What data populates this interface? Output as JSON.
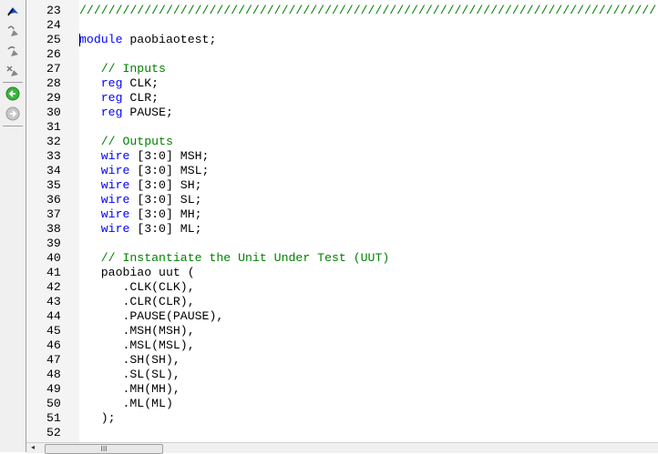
{
  "toolbar": {
    "items": [
      {
        "icon": "bookmark-toggle-icon"
      },
      {
        "icon": "bookmark-previous-icon"
      },
      {
        "icon": "bookmark-next-icon"
      },
      {
        "icon": "bookmark-clear-icon"
      },
      {
        "icon": "back-arrow-icon",
        "color": "#3cb43c"
      },
      {
        "icon": "forward-arrow-icon",
        "color": "#b0b0b0"
      }
    ]
  },
  "colors": {
    "keyword": "#0000ff",
    "comment": "#008000",
    "text": "#000000"
  },
  "lines": [
    {
      "n": "23",
      "tokens": [
        {
          "t": "////////////////////////////////////////////////////////////////////////////////",
          "c": "cm"
        }
      ]
    },
    {
      "n": "24",
      "tokens": []
    },
    {
      "n": "25",
      "tokens": [
        {
          "t": "module",
          "c": "kw"
        },
        {
          "t": " paobiaotest;",
          "c": ""
        }
      ]
    },
    {
      "n": "26",
      "tokens": []
    },
    {
      "n": "27",
      "tokens": [
        {
          "t": "   // Inputs",
          "c": "cm"
        }
      ]
    },
    {
      "n": "28",
      "tokens": [
        {
          "t": "   ",
          "c": ""
        },
        {
          "t": "reg",
          "c": "kw"
        },
        {
          "t": " CLK;",
          "c": ""
        }
      ]
    },
    {
      "n": "29",
      "tokens": [
        {
          "t": "   ",
          "c": ""
        },
        {
          "t": "reg",
          "c": "kw"
        },
        {
          "t": " CLR;",
          "c": ""
        }
      ]
    },
    {
      "n": "30",
      "tokens": [
        {
          "t": "   ",
          "c": ""
        },
        {
          "t": "reg",
          "c": "kw"
        },
        {
          "t": " PAUSE;",
          "c": ""
        }
      ]
    },
    {
      "n": "31",
      "tokens": []
    },
    {
      "n": "32",
      "tokens": [
        {
          "t": "   // Outputs",
          "c": "cm"
        }
      ]
    },
    {
      "n": "33",
      "tokens": [
        {
          "t": "   ",
          "c": ""
        },
        {
          "t": "wire",
          "c": "kw"
        },
        {
          "t": " [3:0] MSH;",
          "c": ""
        }
      ]
    },
    {
      "n": "34",
      "tokens": [
        {
          "t": "   ",
          "c": ""
        },
        {
          "t": "wire",
          "c": "kw"
        },
        {
          "t": " [3:0] MSL;",
          "c": ""
        }
      ]
    },
    {
      "n": "35",
      "tokens": [
        {
          "t": "   ",
          "c": ""
        },
        {
          "t": "wire",
          "c": "kw"
        },
        {
          "t": " [3:0] SH;",
          "c": ""
        }
      ]
    },
    {
      "n": "36",
      "tokens": [
        {
          "t": "   ",
          "c": ""
        },
        {
          "t": "wire",
          "c": "kw"
        },
        {
          "t": " [3:0] SL;",
          "c": ""
        }
      ]
    },
    {
      "n": "37",
      "tokens": [
        {
          "t": "   ",
          "c": ""
        },
        {
          "t": "wire",
          "c": "kw"
        },
        {
          "t": " [3:0] MH;",
          "c": ""
        }
      ]
    },
    {
      "n": "38",
      "tokens": [
        {
          "t": "   ",
          "c": ""
        },
        {
          "t": "wire",
          "c": "kw"
        },
        {
          "t": " [3:0] ML;",
          "c": ""
        }
      ]
    },
    {
      "n": "39",
      "tokens": []
    },
    {
      "n": "40",
      "tokens": [
        {
          "t": "   // Instantiate the Unit Under Test (UUT)",
          "c": "cm"
        }
      ]
    },
    {
      "n": "41",
      "tokens": [
        {
          "t": "   paobiao uut (",
          "c": ""
        }
      ]
    },
    {
      "n": "42",
      "tokens": [
        {
          "t": "      .CLK(CLK),",
          "c": ""
        }
      ]
    },
    {
      "n": "43",
      "tokens": [
        {
          "t": "      .CLR(CLR),",
          "c": ""
        }
      ]
    },
    {
      "n": "44",
      "tokens": [
        {
          "t": "      .PAUSE(PAUSE),",
          "c": ""
        }
      ]
    },
    {
      "n": "45",
      "tokens": [
        {
          "t": "      .MSH(MSH),",
          "c": ""
        }
      ]
    },
    {
      "n": "46",
      "tokens": [
        {
          "t": "      .MSL(MSL),",
          "c": ""
        }
      ]
    },
    {
      "n": "47",
      "tokens": [
        {
          "t": "      .SH(SH),",
          "c": ""
        }
      ]
    },
    {
      "n": "48",
      "tokens": [
        {
          "t": "      .SL(SL),",
          "c": ""
        }
      ]
    },
    {
      "n": "49",
      "tokens": [
        {
          "t": "      .MH(MH),",
          "c": ""
        }
      ]
    },
    {
      "n": "50",
      "tokens": [
        {
          "t": "      .ML(ML)",
          "c": ""
        }
      ]
    },
    {
      "n": "51",
      "tokens": [
        {
          "t": "   );",
          "c": ""
        }
      ]
    },
    {
      "n": "52",
      "tokens": []
    }
  ],
  "scrollbar": {
    "thumb_grip": "III",
    "left_arrow": "◂"
  }
}
